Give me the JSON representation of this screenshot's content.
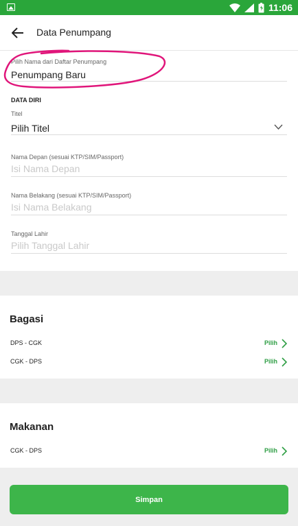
{
  "status_bar": {
    "time": "11:06"
  },
  "app_bar": {
    "title": "Data Penumpang"
  },
  "passenger_select": {
    "label": "Pilih Nama dari Daftar Penumpang",
    "value": "Penumpang Baru"
  },
  "data_diri": {
    "section_label": "DATA DIRI",
    "title_field": {
      "label": "Titel",
      "value": "Pilih Titel"
    },
    "first_name": {
      "label": "Nama Depan (sesuai KTP/SIM/Passport)",
      "placeholder": "Isi Nama Depan"
    },
    "last_name": {
      "label": "Nama Belakang (sesuai KTP/SIM/Passport)",
      "placeholder": "Isi Nama Belakang"
    },
    "birth_date": {
      "label": "Tanggal Lahir",
      "placeholder": "Pilih Tanggal Lahir"
    }
  },
  "bagasi": {
    "title": "Bagasi",
    "routes": [
      {
        "route": "DPS - CGK",
        "action": "Pilih"
      },
      {
        "route": "CGK - DPS",
        "action": "Pilih"
      }
    ]
  },
  "makanan": {
    "title": "Makanan",
    "routes": [
      {
        "route": "CGK - DPS",
        "action": "Pilih"
      }
    ]
  },
  "save_button": {
    "label": "Simpan"
  },
  "colors": {
    "brand_green": "#2aa63a",
    "button_green": "#3db54a",
    "link_green": "#2e9e44",
    "highlight_magenta": "#e0157a"
  }
}
